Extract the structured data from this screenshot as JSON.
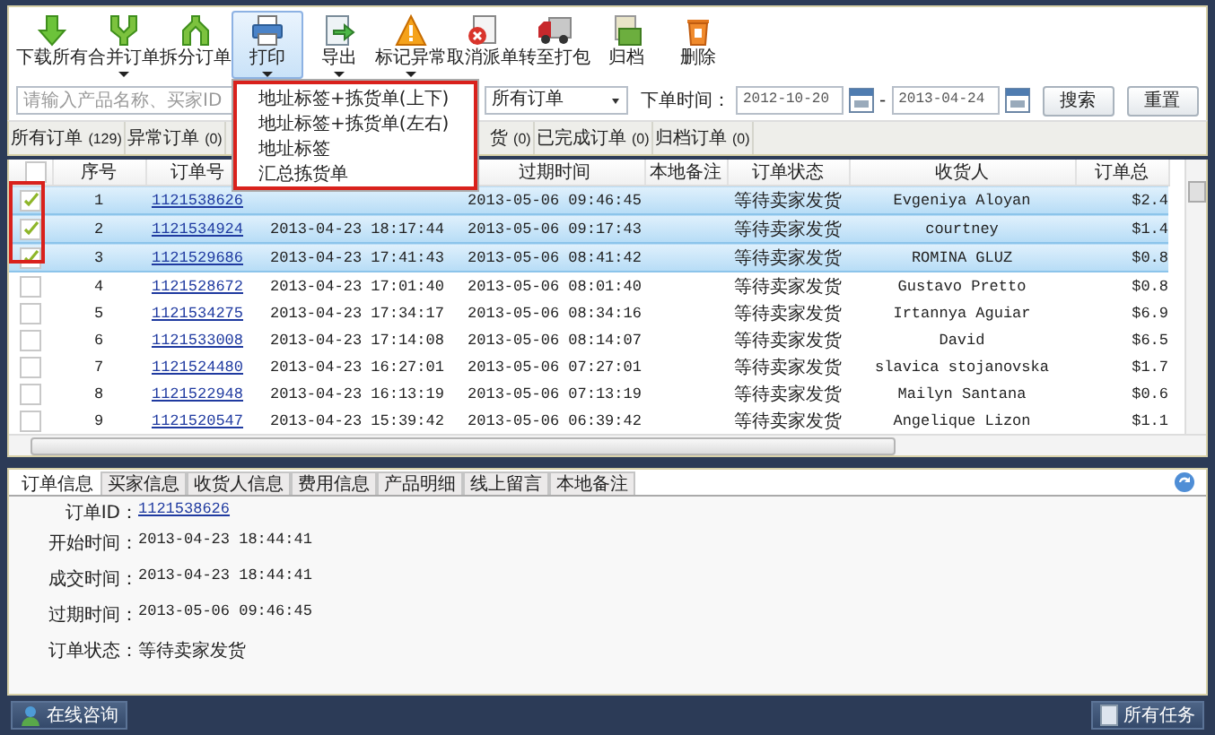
{
  "toolbar": [
    {
      "label": "下载所有",
      "caret": false,
      "selected": false
    },
    {
      "label": "合并订单",
      "caret": true,
      "selected": false
    },
    {
      "label": "拆分订单",
      "caret": false,
      "selected": false
    },
    {
      "label": "打印",
      "caret": true,
      "selected": true
    },
    {
      "label": "导出",
      "caret": true,
      "selected": false
    },
    {
      "label": "标记异常",
      "caret": true,
      "selected": false
    },
    {
      "label": "取消派单",
      "caret": false,
      "selected": false
    },
    {
      "label": "转至打包",
      "caret": false,
      "selected": false
    },
    {
      "label": "归档",
      "caret": false,
      "selected": false
    },
    {
      "label": "删除",
      "caret": false,
      "selected": false
    }
  ],
  "print_menu": {
    "items": [
      "地址标签+拣货单(上下)",
      "地址标签+拣货单(左右)",
      "地址标签",
      "汇总拣货单"
    ]
  },
  "search": {
    "placeholder": "请输入产品名称、买家ID"
  },
  "order_filter": {
    "value": "所有订单"
  },
  "date_range": {
    "label": "下单时间：",
    "from": "2012-10-20",
    "separator": "-",
    "to": "2013-04-24"
  },
  "buttons": [
    "搜索",
    "重置"
  ],
  "status_tabs": [
    {
      "label": "所有订单",
      "count": "(129)"
    },
    {
      "label": "异常订单",
      "count": "(0)"
    },
    {
      "label": "货",
      "count": "(0)"
    },
    {
      "label": "已完成订单",
      "count": "(0)"
    },
    {
      "label": "归档订单",
      "count": "(0)"
    }
  ],
  "table": {
    "header_checked": false,
    "columns": [
      "序号",
      "订单号",
      "过期时间",
      "本地备注",
      "订单状态",
      "收货人",
      "订单总"
    ],
    "rows": [
      {
        "checked": true,
        "selected": true,
        "no": "1",
        "order_id": "1121538626",
        "expires": "2013-05-06 09:46:45",
        "status": "等待卖家发货",
        "consignee": "Evgeniya Aloyan",
        "total": "$2.4"
      },
      {
        "checked": true,
        "selected": true,
        "no": "2",
        "order_id": "1121534924",
        "created": "2013-04-23 18:17:44",
        "expires": "2013-05-06 09:17:43",
        "status": "等待卖家发货",
        "consignee": "courtney",
        "total": "$1.4"
      },
      {
        "checked": true,
        "selected": true,
        "no": "3",
        "order_id": "1121529686",
        "created": "2013-04-23 17:41:43",
        "expires": "2013-05-06 08:41:42",
        "status": "等待卖家发货",
        "consignee": "ROMINA GLUZ",
        "total": "$0.8"
      },
      {
        "checked": false,
        "selected": false,
        "no": "4",
        "order_id": "1121528672",
        "created": "2013-04-23 17:01:40",
        "expires": "2013-05-06 08:01:40",
        "status": "等待卖家发货",
        "consignee": "Gustavo Pretto",
        "total": "$0.8"
      },
      {
        "checked": false,
        "selected": false,
        "no": "5",
        "order_id": "1121534275",
        "created": "2013-04-23 17:34:17",
        "expires": "2013-05-06 08:34:16",
        "status": "等待卖家发货",
        "consignee": "Irtannya Aguiar",
        "total": "$6.9"
      },
      {
        "checked": false,
        "selected": false,
        "no": "6",
        "order_id": "1121533008",
        "created": "2013-04-23 17:14:08",
        "expires": "2013-05-06 08:14:07",
        "status": "等待卖家发货",
        "consignee": "David",
        "total": "$6.5"
      },
      {
        "checked": false,
        "selected": false,
        "no": "7",
        "order_id": "1121524480",
        "created": "2013-04-23 16:27:01",
        "expires": "2013-05-06 07:27:01",
        "status": "等待卖家发货",
        "consignee": "slavica stojanovska",
        "total": "$1.7"
      },
      {
        "checked": false,
        "selected": false,
        "no": "8",
        "order_id": "1121522948",
        "created": "2013-04-23 16:13:19",
        "expires": "2013-05-06 07:13:19",
        "status": "等待卖家发货",
        "consignee": "Mailyn Santana",
        "total": "$0.6"
      },
      {
        "checked": false,
        "selected": false,
        "no": "9",
        "order_id": "1121520547",
        "created": "2013-04-23 15:39:42",
        "expires": "2013-05-06 06:39:42",
        "status": "等待卖家发货",
        "consignee": "Angelique Lizon",
        "total": "$1.1"
      }
    ]
  },
  "detail_tabs": [
    {
      "label": "订单信息",
      "selected": true
    },
    {
      "label": "买家信息",
      "selected": false
    },
    {
      "label": "收货人信息",
      "selected": false
    },
    {
      "label": "费用信息",
      "selected": false
    },
    {
      "label": "产品明细",
      "selected": false
    },
    {
      "label": "线上留言",
      "selected": false
    },
    {
      "label": "本地备注",
      "selected": false
    }
  ],
  "detail": [
    {
      "label": "订单ID：",
      "value": "1121538626",
      "kind": "link"
    },
    {
      "label": "开始时间：",
      "value": "2013-04-23 18:44:41",
      "kind": "text"
    },
    {
      "label": "成交时间：",
      "value": "2013-04-23 18:44:41",
      "kind": "text"
    },
    {
      "label": "过期时间：",
      "value": "2013-05-06 09:46:45",
      "kind": "text"
    },
    {
      "label": "订单状态：",
      "value": "等待卖家发货",
      "kind": "text"
    }
  ],
  "footer": {
    "consult": "在线咨询",
    "tasks": "所有任务"
  }
}
